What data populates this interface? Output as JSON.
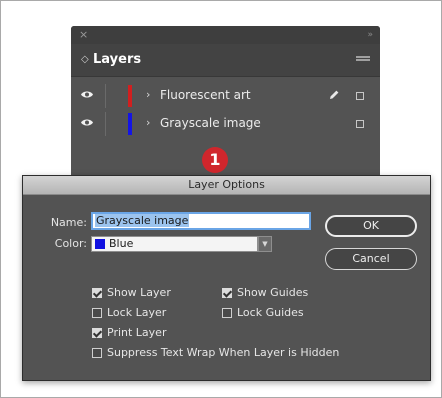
{
  "layers_panel": {
    "close_glyph": "×",
    "collapse_glyph": "»",
    "tab_arrows_glyph": "◇",
    "tab_title": "Layers",
    "rows": [
      {
        "name": "Fluorescent art",
        "color": "#d21f1f",
        "expand_glyph": "›",
        "visible": true,
        "editable": true
      },
      {
        "name": "Grayscale image",
        "color": "#1414e6",
        "expand_glyph": "›",
        "visible": true,
        "editable": false
      }
    ]
  },
  "callout": {
    "number": "1",
    "color": "#d0262c"
  },
  "dialog": {
    "title": "Layer Options",
    "name_label": "Name:",
    "name_value": "Grayscale image",
    "color_label": "Color:",
    "color_value": "Blue",
    "color_swatch": "#1010e0",
    "ok_label": "OK",
    "cancel_label": "Cancel",
    "options": {
      "show_layer": {
        "label": "Show Layer",
        "checked": true
      },
      "lock_layer": {
        "label": "Lock Layer",
        "checked": false
      },
      "print_layer": {
        "label": "Print Layer",
        "checked": true
      },
      "suppress_text_wrap": {
        "label": "Suppress Text Wrap When Layer is Hidden",
        "checked": false
      },
      "show_guides": {
        "label": "Show Guides",
        "checked": true
      },
      "lock_guides": {
        "label": "Lock Guides",
        "checked": false
      }
    }
  }
}
